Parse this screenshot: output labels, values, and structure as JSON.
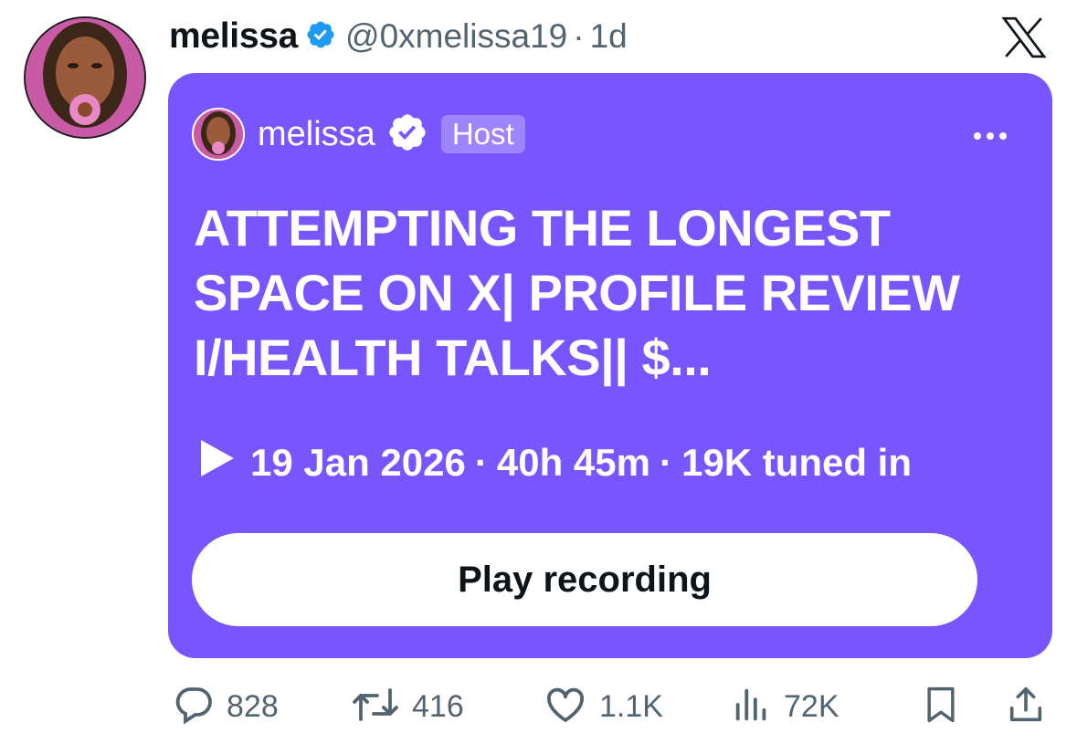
{
  "author": {
    "display_name": "melissa",
    "handle": "@0xmelissa19",
    "separator": "·",
    "timestamp": "1d"
  },
  "space": {
    "host_name": "melissa",
    "host_badge": "Host",
    "title": "ATTEMPTING THE LONGEST SPACE ON X| PROFILE REVIEW I/HEALTH TALKS|| $...",
    "date": "19 Jan 2026",
    "duration": "40h 45m",
    "listeners": "19K tuned in",
    "separator": "·",
    "play_label": "Play recording",
    "card_color": "#7856ff"
  },
  "actions": {
    "replies": "828",
    "reposts": "416",
    "likes": "1.1K",
    "views": "72K"
  },
  "colors": {
    "verified_blue": "#1d9bf0",
    "muted_text": "#536471"
  },
  "icons": [
    "verified-badge-icon",
    "x-logo-icon",
    "more-icon",
    "play-icon",
    "reply-icon",
    "repost-icon",
    "like-icon",
    "views-icon",
    "bookmark-icon",
    "share-icon"
  ]
}
